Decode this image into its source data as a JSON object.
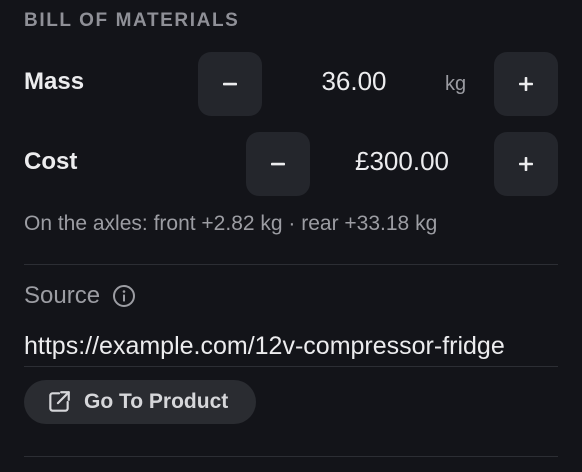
{
  "section": {
    "title": "BILL OF MATERIALS"
  },
  "mass": {
    "label": "Mass",
    "value": "36.00",
    "unit": "kg",
    "decrement_icon": "minus-icon",
    "increment_icon": "plus-icon"
  },
  "cost": {
    "label": "Cost",
    "value": "£300.00",
    "decrement_icon": "minus-icon",
    "increment_icon": "plus-icon"
  },
  "axles_note": "On the axles: front +2.82 kg · rear +33.18 kg",
  "source": {
    "label": "Source",
    "info_icon": "info-icon",
    "url": "https://example.com/12v-compressor-fridge"
  },
  "go_button": {
    "label": "Go To Product",
    "icon": "external-link-icon"
  },
  "colors": {
    "background": "#131419",
    "button_bg": "#24262c",
    "text_primary": "#ececee",
    "text_muted": "#9c9da3"
  }
}
